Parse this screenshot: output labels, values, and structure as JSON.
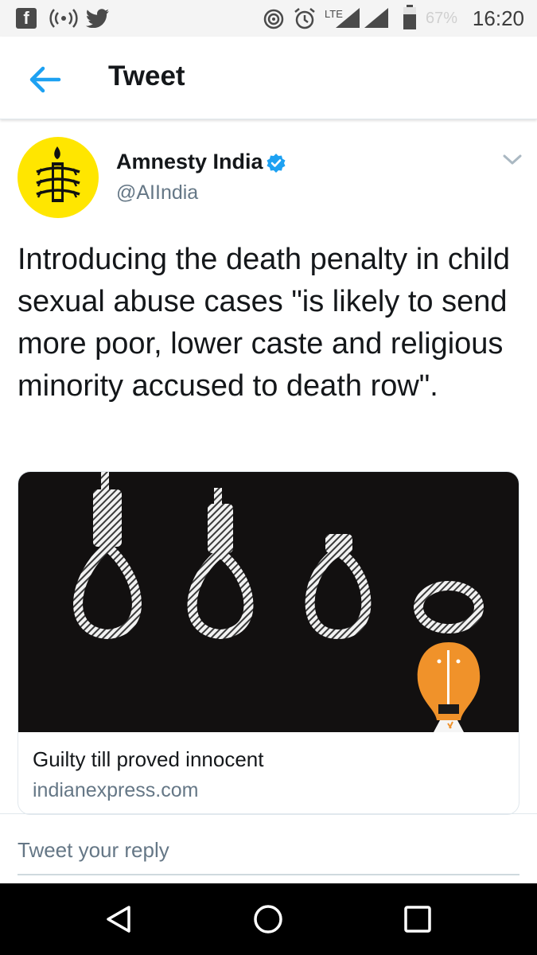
{
  "status_bar": {
    "fb_glyph": "f",
    "network": "LTE",
    "battery": "67%",
    "time": "16:20"
  },
  "header": {
    "title": "Tweet"
  },
  "tweet": {
    "author_name": "Amnesty India",
    "author_handle": "@AIIndia",
    "text": "Introducing the death penalty in child sexual abuse cases \"is likely to send more poor, lower caste and religious minority accused to death row\".",
    "card": {
      "title": "Guilty till proved innocent",
      "domain": "indianexpress.com"
    }
  },
  "reply": {
    "placeholder": "Tweet your reply"
  },
  "colors": {
    "accent": "#1da1f2",
    "avatar_bg": "#ffe600",
    "card_image_bg": "#121010",
    "figure_orange": "#f0922a"
  },
  "icons": [
    "facebook-icon",
    "wifi-hotspot-icon",
    "twitter-icon",
    "hotspot-icon",
    "alarm-icon",
    "signal-icon",
    "battery-icon",
    "back-arrow-icon",
    "verified-icon",
    "chevron-down-icon",
    "nav-back-icon",
    "nav-home-icon",
    "nav-recents-icon"
  ]
}
